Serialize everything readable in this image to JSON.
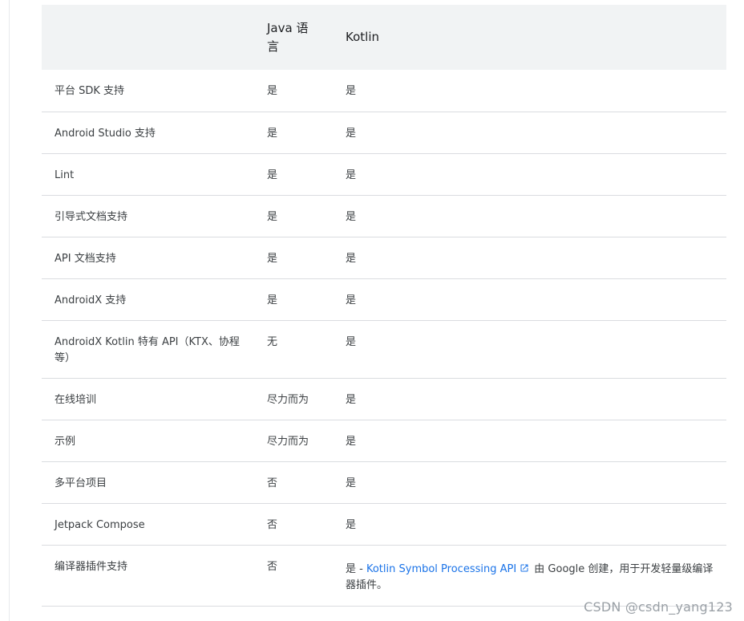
{
  "table": {
    "header": {
      "col1": "",
      "col2": "Java 语言",
      "col3": "Kotlin"
    },
    "rows": [
      {
        "feature": "平台 SDK 支持",
        "java": "是",
        "kotlin": "是"
      },
      {
        "feature": "Android Studio 支持",
        "java": "是",
        "kotlin": "是"
      },
      {
        "feature": "Lint",
        "java": "是",
        "kotlin": "是"
      },
      {
        "feature": "引导式文档支持",
        "java": "是",
        "kotlin": "是"
      },
      {
        "feature": "API 文档支持",
        "java": "是",
        "kotlin": "是"
      },
      {
        "feature": "AndroidX 支持",
        "java": "是",
        "kotlin": "是"
      },
      {
        "feature": "AndroidX Kotlin 特有 API（KTX、协程等）",
        "java": "无",
        "kotlin": "是"
      },
      {
        "feature": "在线培训",
        "java": "尽力而为",
        "kotlin": "是"
      },
      {
        "feature": "示例",
        "java": "尽力而为",
        "kotlin": "是"
      },
      {
        "feature": "多平台项目",
        "java": "否",
        "kotlin": "是"
      },
      {
        "feature": "Jetpack Compose",
        "java": "否",
        "kotlin": "是"
      },
      {
        "feature": "编译器插件支持",
        "java": "否",
        "kotlin_prefix": "是 - ",
        "kotlin_link": "Kotlin Symbol Processing API",
        "kotlin_link_icon": "external-link-icon",
        "kotlin_suffix": " 由 Google 创建，用于开发轻量级编译器插件。"
      }
    ]
  },
  "watermark": "CSDN @csdn_yang123",
  "colors": {
    "header_bg": "#f1f3f4",
    "row_border": "#dadce0",
    "link": "#1a73e8",
    "text": "#3c4043"
  }
}
